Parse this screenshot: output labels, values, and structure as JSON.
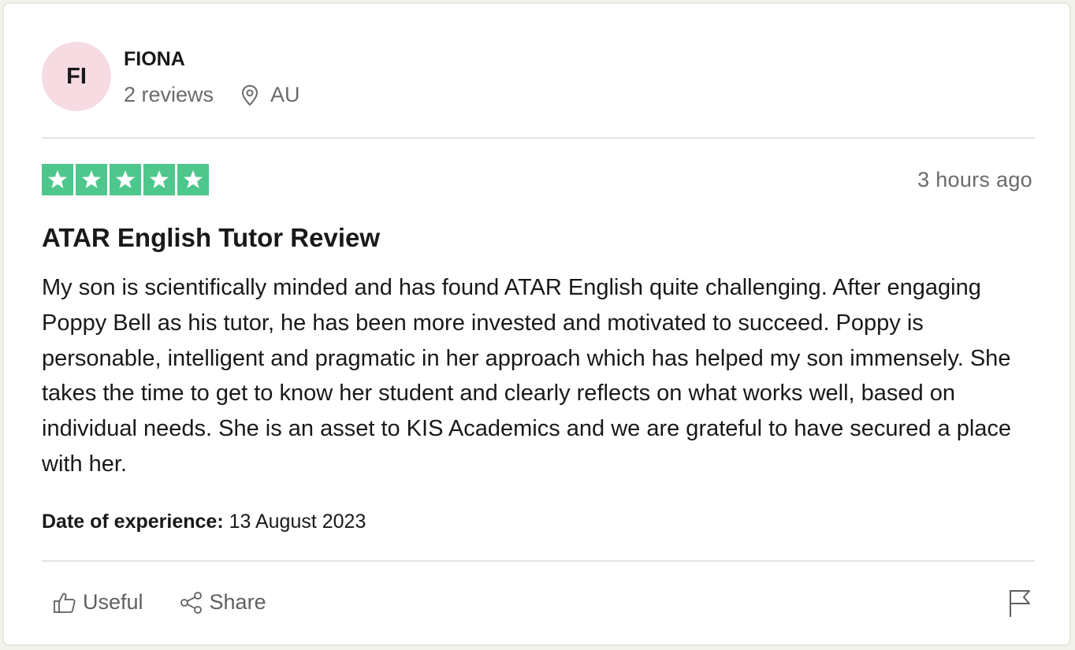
{
  "reviewer": {
    "initials": "FI",
    "name": "FIONA",
    "reviews_count": "2 reviews",
    "location": "AU"
  },
  "review": {
    "rating": 5,
    "rating_max": 5,
    "star_color": "#4ec78d",
    "timestamp": "3 hours ago",
    "title": "ATAR English Tutor Review",
    "body": "My son is scientifically minded and has found ATAR English quite challenging. After engaging Poppy Bell as his tutor, he has been more invested and motivated to succeed. Poppy is personable, intelligent and pragmatic in her approach which has helped my son immensely. She takes the time to get to know her student and clearly reflects on what works well, based on individual needs. She is an asset to KIS Academics and we are grateful to have secured a place with her.",
    "experience_label": "Date of experience:",
    "experience_date": "13 August 2023"
  },
  "actions": {
    "useful_label": "Useful",
    "share_label": "Share",
    "useful_icon": "thumbs-up-icon",
    "share_icon": "share-icon",
    "report_icon": "flag-icon"
  },
  "colors": {
    "avatar_bg": "#f7dbe2",
    "text_primary": "#191919",
    "text_secondary": "#6b6b6b"
  }
}
